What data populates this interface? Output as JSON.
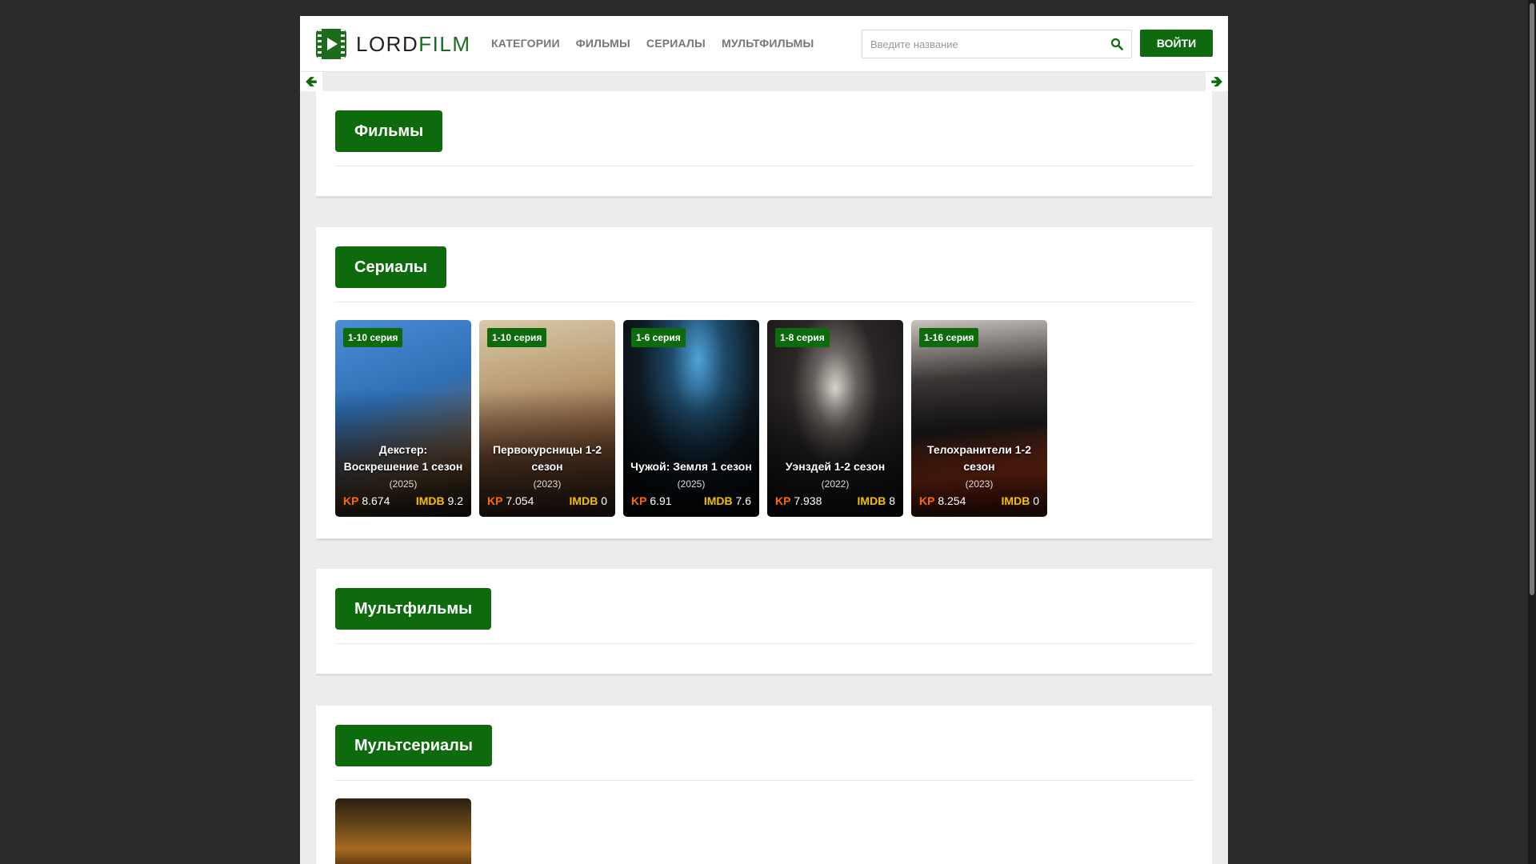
{
  "header": {
    "logo_part1": "LORD",
    "logo_part2": "FILM",
    "nav": [
      "КАТЕГОРИИ",
      "ФИЛЬМЫ",
      "СЕРИАЛЫ",
      "МУЛЬТФИЛЬМЫ"
    ],
    "search_placeholder": "Введите название",
    "login_label": "ВОЙТИ"
  },
  "sections": {
    "films": {
      "title": "Фильмы"
    },
    "series": {
      "title": "Сериалы",
      "cards": [
        {
          "badge": "1-10 серия",
          "title": "Декстер: Воскрешение 1 сезон",
          "year": "(2025)",
          "kp_label": "KP",
          "kp": "8.674",
          "imdb_label": "IMDB",
          "imdb": "9.2"
        },
        {
          "badge": "1-10 серия",
          "title": "Первокурсницы 1-2 сезон",
          "year": "(2023)",
          "kp_label": "KP",
          "kp": "7.054",
          "imdb_label": "IMDB",
          "imdb": "0"
        },
        {
          "badge": "1-6 серия",
          "title": "Чужой: Земля 1 сезон",
          "year": "(2025)",
          "kp_label": "KP",
          "kp": "6.91",
          "imdb_label": "IMDB",
          "imdb": "7.6"
        },
        {
          "badge": "1-8 серия",
          "title": "Уэнздей 1-2 сезон",
          "year": "(2022)",
          "kp_label": "KP",
          "kp": "7.938",
          "imdb_label": "IMDB",
          "imdb": "8"
        },
        {
          "badge": "1-16 серия",
          "title": "Телохранители 1-2 сезон",
          "year": "(2023)",
          "kp_label": "KP",
          "kp": "8.254",
          "imdb_label": "IMDB",
          "imdb": "0"
        }
      ]
    },
    "cartoons": {
      "title": "Мультфильмы"
    },
    "animated_series": {
      "title": "Мультсериалы"
    }
  },
  "colors": {
    "accent": "#0d6b0d",
    "kp": "#ff6a00",
    "imdb": "#f2c000"
  },
  "icons": {
    "search": "search-icon",
    "prev": "arrow-left-icon",
    "next": "arrow-right-icon"
  }
}
